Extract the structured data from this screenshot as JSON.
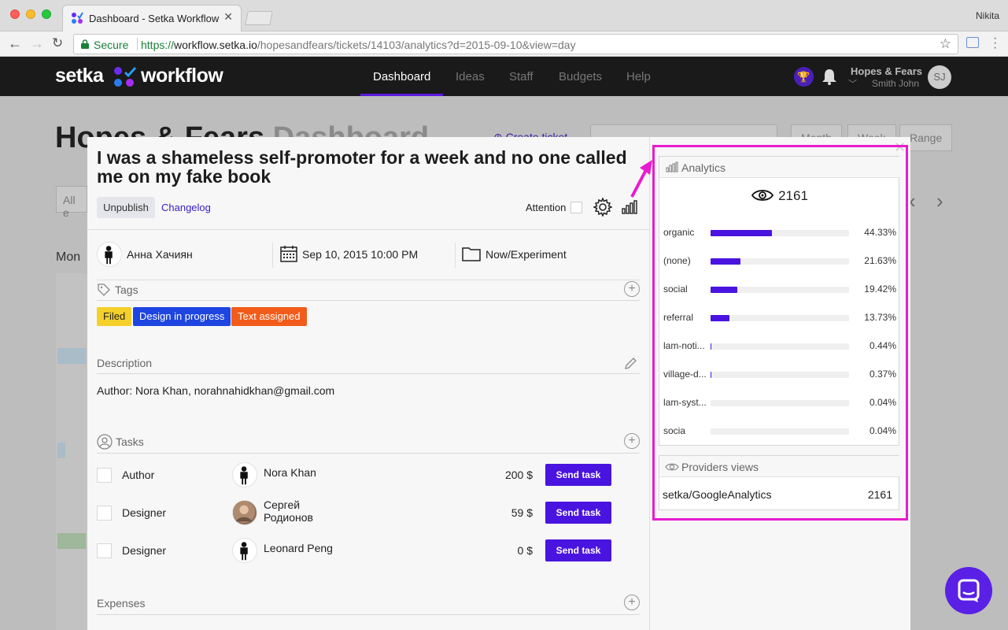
{
  "browser": {
    "tab_title": "Dashboard - Setka Workflow",
    "user": "Nikita",
    "secure_label": "Secure",
    "url_scheme": "https://",
    "url_host": "workflow.setka.io",
    "url_path": "/hopesandfears/tickets/14103/analytics?d=2015-09-10&view=day"
  },
  "app": {
    "logo_left": "setka",
    "logo_right": "workflow",
    "nav": [
      "Dashboard",
      "Ideas",
      "Staff",
      "Budgets",
      "Help"
    ],
    "active_nav": "Dashboard",
    "org_name": "Hopes & Fears",
    "org_user": "Smith John",
    "avatar_initials": "SJ",
    "accent": "#4a14e0"
  },
  "background_page": {
    "title_main": "Hopes & Fears",
    "title_muted": "Dashboard",
    "create_ticket": "Create ticket",
    "segments": [
      "Month",
      "Week",
      "Range"
    ],
    "filter": "All e",
    "day_label": "Mon"
  },
  "ticket": {
    "title": "I was a shameless self-promoter for a week and no one called me on my fake book",
    "unpublish": "Unpublish",
    "changelog": "Changelog",
    "attention": "Attention",
    "author": "Анна Хачиян",
    "date": "Sep 10, 2015 10:00 PM",
    "folder": "Now/Experiment",
    "tags_heading": "Tags",
    "tags": [
      {
        "label": "Filed",
        "bg": "#f5cf2a",
        "fg": "#222"
      },
      {
        "label": "Design in progress",
        "bg": "#1f45e0",
        "fg": "#fff"
      },
      {
        "label": "Text assigned",
        "bg": "#f25c1a",
        "fg": "#fff"
      }
    ],
    "description_heading": "Description",
    "description": "Author: Nora Khan, norahnahidkhan@gmail.com",
    "tasks_heading": "Tasks",
    "tasks": [
      {
        "role": "Author",
        "name_line1": "Nora Khan",
        "name_line2": "",
        "price": "200 $",
        "button": "Send task"
      },
      {
        "role": "Designer",
        "name_line1": "Сергей",
        "name_line2": "Родионов",
        "price": "59 $",
        "button": "Send task"
      },
      {
        "role": "Designer",
        "name_line1": "Leonard Peng",
        "name_line2": "",
        "price": "0 $",
        "button": "Send task"
      }
    ],
    "expenses_heading": "Expenses"
  },
  "analytics": {
    "heading": "Analytics",
    "total_views": "2161",
    "sources": [
      {
        "label": "organic",
        "pct": "44.33%",
        "value": 44.33
      },
      {
        "label": "(none)",
        "pct": "21.63%",
        "value": 21.63
      },
      {
        "label": "social",
        "pct": "19.42%",
        "value": 19.42
      },
      {
        "label": "referral",
        "pct": "13.73%",
        "value": 13.73
      },
      {
        "label": "lam-noti...",
        "pct": "0.44%",
        "value": 0.44
      },
      {
        "label": "village-d...",
        "pct": "0.37%",
        "value": 0.37
      },
      {
        "label": "lam-syst...",
        "pct": "0.04%",
        "value": 0.04
      },
      {
        "label": "socia",
        "pct": "0.04%",
        "value": 0.04
      }
    ],
    "providers_heading": "Providers views",
    "provider_name": "setka/GoogleAnalytics",
    "provider_count": "2161"
  }
}
